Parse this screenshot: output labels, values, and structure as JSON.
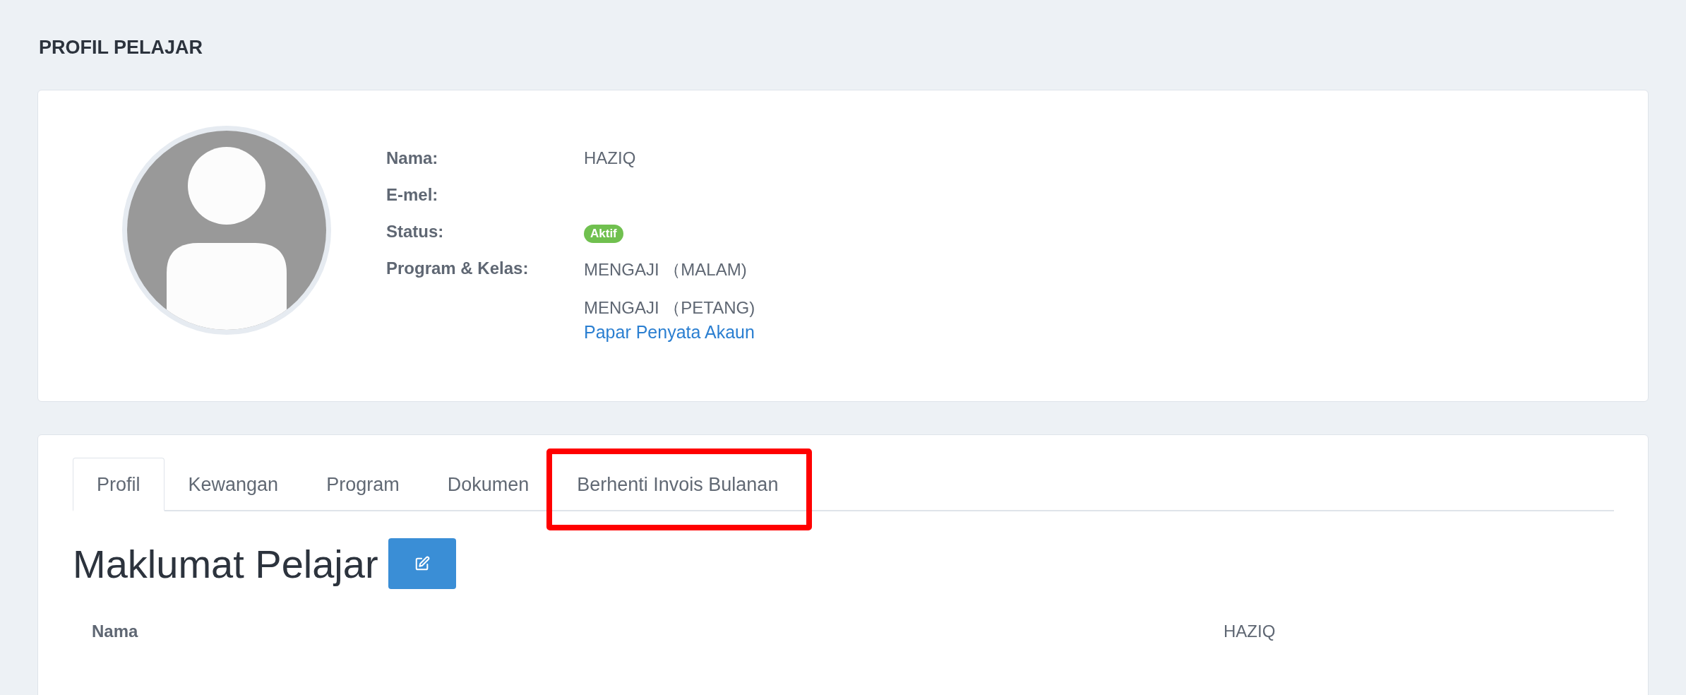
{
  "page_title": "PROFIL PELAJAR",
  "profile": {
    "fields": [
      {
        "label": "Nama:",
        "values": [
          "HAZIQ"
        ],
        "kind": "text"
      },
      {
        "label": "E-mel:"
      },
      {
        "label": "Status:",
        "values": [
          "Aktif"
        ],
        "kind": "badge"
      },
      {
        "label": "Program & Kelas:",
        "values": [
          "MENGAJI （MALAM)",
          "MENGAJI （PETANG)"
        ],
        "kind": "text"
      }
    ],
    "link": "Papar Penyata Akaun"
  },
  "tabs": [
    {
      "label": "Profil",
      "selected": true,
      "highlighted": false
    },
    {
      "label": "Kewangan",
      "selected": false,
      "highlighted": false
    },
    {
      "label": "Program",
      "selected": false,
      "highlighted": false
    },
    {
      "label": "Dokumen",
      "selected": false,
      "highlighted": false
    },
    {
      "label": "Berhenti Invois Bulanan",
      "selected": false,
      "highlighted": true
    }
  ],
  "section": {
    "title": "Maklumat Pelajar",
    "rows": [
      {
        "label": "Nama",
        "value": "HAZIQ"
      }
    ]
  }
}
